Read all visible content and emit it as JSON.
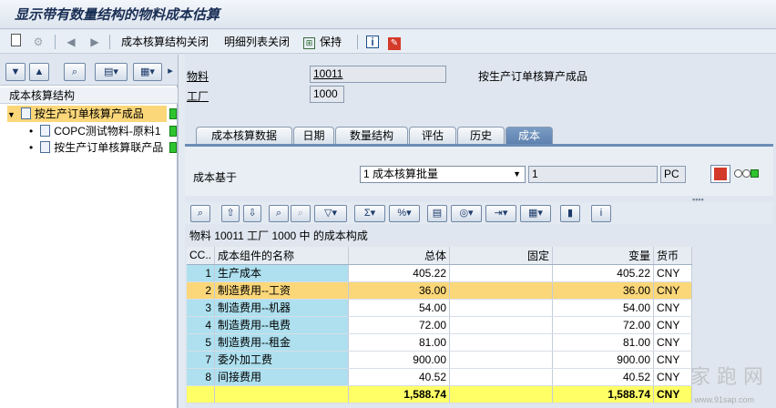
{
  "window": {
    "title": "显示带有数量结构的物料成本估算"
  },
  "toolbar": {
    "close_cost_structure": "成本核算结构关闭",
    "close_detail_list": "明细列表关闭",
    "keep": "保持"
  },
  "tree": {
    "header": "成本核算结构",
    "root": "按生产订单核算产成品",
    "children": [
      "COPC测试物料-原料1",
      "按生产订单核算联产品"
    ]
  },
  "header_fields": {
    "material_label": "物料",
    "material_value": "10011",
    "material_desc": "按生产订单核算产成品",
    "plant_label": "工厂",
    "plant_value": "1000"
  },
  "tabs": [
    "成本核算数据",
    "日期",
    "数量结构",
    "评估",
    "历史",
    "成本"
  ],
  "active_tab": "成本",
  "cost_base": {
    "label": "成本基于",
    "selected": "1 成本核算批量",
    "qty": "1",
    "unit": "PC"
  },
  "grid": {
    "title": "物料 10011 工厂 1000 中 的成本构成",
    "columns": [
      "CC..",
      "成本组件的名称",
      "总体",
      "固定",
      "变量",
      "货币"
    ],
    "rows": [
      {
        "cc": "1",
        "name": "生产成本",
        "total": "405.22",
        "fixed": "",
        "variable": "405.22",
        "cur": "CNY"
      },
      {
        "cc": "2",
        "name": "制造费用--工资",
        "total": "36.00",
        "fixed": "",
        "variable": "36.00",
        "cur": "CNY"
      },
      {
        "cc": "3",
        "name": "制造费用--机器",
        "total": "54.00",
        "fixed": "",
        "variable": "54.00",
        "cur": "CNY"
      },
      {
        "cc": "4",
        "name": "制造费用--电费",
        "total": "72.00",
        "fixed": "",
        "variable": "72.00",
        "cur": "CNY"
      },
      {
        "cc": "5",
        "name": "制造费用--租金",
        "total": "81.00",
        "fixed": "",
        "variable": "81.00",
        "cur": "CNY"
      },
      {
        "cc": "7",
        "name": "委外加工费",
        "total": "900.00",
        "fixed": "",
        "variable": "900.00",
        "cur": "CNY"
      },
      {
        "cc": "8",
        "name": "间接费用",
        "total": "40.52",
        "fixed": "",
        "variable": "40.52",
        "cur": "CNY"
      }
    ],
    "sum": {
      "total": "1,588.74",
      "variable": "1,588.74",
      "cur": "CNY"
    }
  },
  "watermark": {
    "text": "家 跑 网",
    "url": "www.91sap.com"
  }
}
